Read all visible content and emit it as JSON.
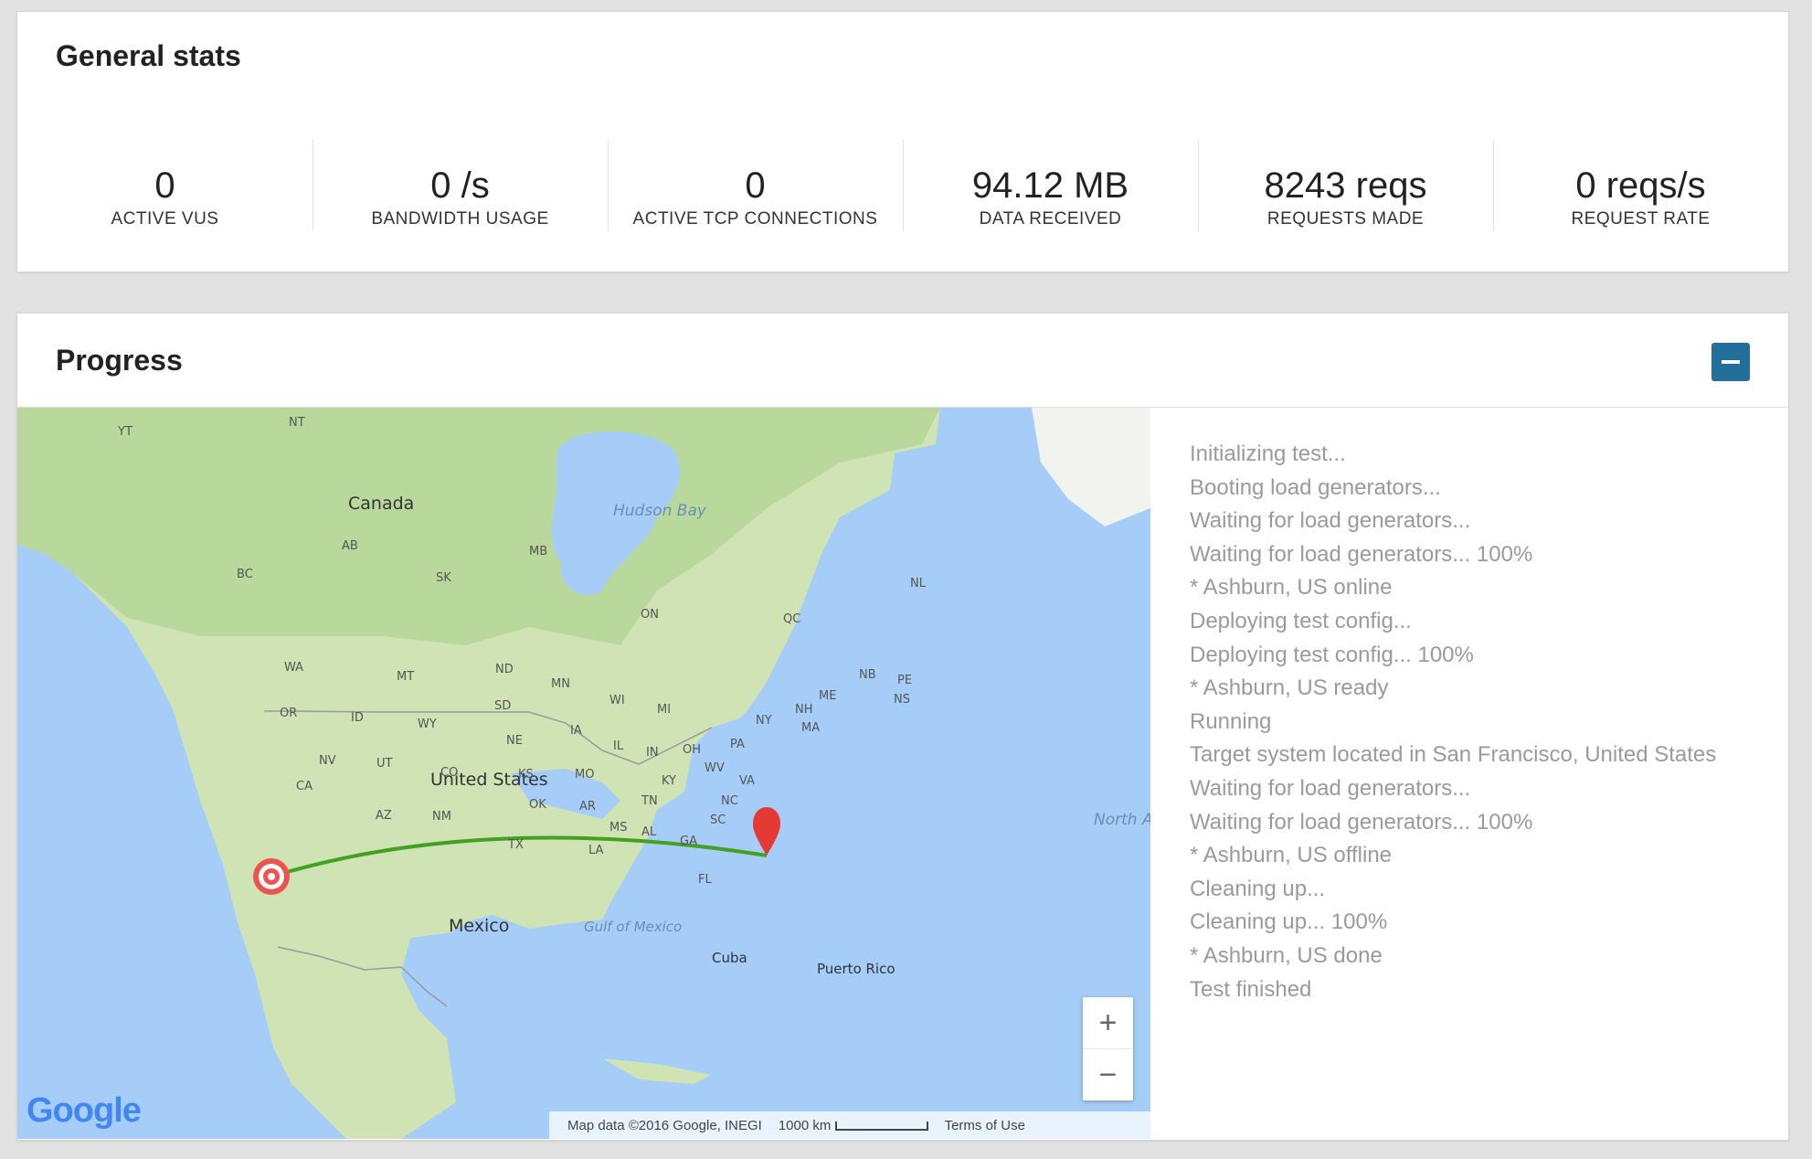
{
  "general": {
    "title": "General stats",
    "stats": [
      {
        "value": "0",
        "label": "ACTIVE VUS"
      },
      {
        "value": "0 /s",
        "label": "BANDWIDTH USAGE"
      },
      {
        "value": "0",
        "label": "ACTIVE TCP CONNECTIONS"
      },
      {
        "value": "94.12 MB",
        "label": "DATA RECEIVED"
      },
      {
        "value": "8243 reqs",
        "label": "REQUESTS MADE"
      },
      {
        "value": "0 reqs/s",
        "label": "REQUEST RATE"
      }
    ]
  },
  "progress": {
    "title": "Progress",
    "collapse_icon": "minus-icon",
    "log": [
      "Initializing test...",
      "Booting load generators...",
      "Waiting for load generators...",
      "Waiting for load generators... 100%",
      "* Ashburn, US online",
      "Deploying test config...",
      "Deploying test config... 100%",
      "* Ashburn, US ready",
      "Running",
      "Target system located in San Francisco, United States",
      "Waiting for load generators...",
      "Waiting for load generators... 100%",
      "* Ashburn, US offline",
      "Cleaning up...",
      "Cleaning up... 100%",
      "* Ashburn, US done",
      "Test finished"
    ]
  },
  "map": {
    "labels": {
      "canada": "Canada",
      "hudson_bay": "Hudson Bay",
      "united_states": "United States",
      "mexico": "Mexico",
      "gulf": "Gulf of Mexico",
      "cuba": "Cuba",
      "puerto_rico": "Puerto Rico",
      "atlantic": "North Atlantic Ocean",
      "yt": "YT",
      "nt": "NT",
      "bc": "BC",
      "ab": "AB",
      "sk": "SK",
      "mb": "MB",
      "on": "ON",
      "qc": "QC",
      "nl": "NL",
      "nb": "NB",
      "ns": "NS",
      "pe": "PE",
      "wa": "WA",
      "or": "OR",
      "ca": "CA",
      "nv": "NV",
      "id": "ID",
      "mt": "MT",
      "wy": "WY",
      "ut": "UT",
      "co": "CO",
      "az": "AZ",
      "nm": "NM",
      "nd": "ND",
      "sd": "SD",
      "ne": "NE",
      "ks": "KS",
      "ok": "OK",
      "tx": "TX",
      "mn": "MN",
      "ia": "IA",
      "mo": "MO",
      "ar": "AR",
      "la": "LA",
      "wi": "WI",
      "il": "IL",
      "mi": "MI",
      "in": "IN",
      "oh": "OH",
      "ky": "KY",
      "tn": "TN",
      "ms": "MS",
      "al": "AL",
      "ga": "GA",
      "fl": "FL",
      "sc": "SC",
      "nc": "NC",
      "va": "VA",
      "wv": "WV",
      "pa": "PA",
      "ny": "NY",
      "me": "ME",
      "ma": "MA",
      "nh": "NH"
    },
    "google": "Google",
    "attribution": "Map data ©2016 Google, INEGI",
    "scale_label": "1000 km",
    "terms": "Terms of Use",
    "zoom_in": "+",
    "zoom_out": "−"
  }
}
